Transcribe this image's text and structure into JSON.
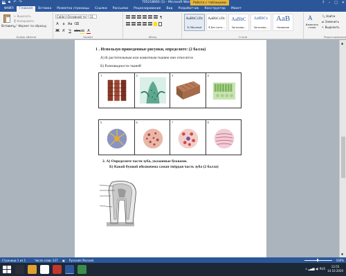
{
  "window": {
    "title": "705218660 (1) - Microsoft Word",
    "context_tab": "Работа с таблицами",
    "controls": [
      "?",
      "–",
      "□",
      "✕"
    ]
  },
  "ribbon_tabs": [
    {
      "label": "ФАЙЛ"
    },
    {
      "label": "Главная"
    },
    {
      "label": "Вставка"
    },
    {
      "label": "Разметка страницы"
    },
    {
      "label": "Ссылки"
    },
    {
      "label": "Рассылки"
    },
    {
      "label": "Рецензирование"
    },
    {
      "label": "Вид"
    },
    {
      "label": "Разработчик"
    },
    {
      "label": "Конструктор"
    },
    {
      "label": "Макет"
    }
  ],
  "clipboard": {
    "paste_label": "Вставить",
    "cut_label": "Вырезать",
    "copy_label": "Копировать",
    "format_label": "Формат по образцу",
    "group_label": "Буфер обмена"
  },
  "font": {
    "font_name": "Calibri (Основной те",
    "font_size": "11",
    "group_label": "Шрифт"
  },
  "paragraph": {
    "group_label": "Абзац"
  },
  "styles": {
    "items": [
      {
        "sample": "AaBbCcDc",
        "name": "¶ Обычный"
      },
      {
        "sample": "AaBbCcDc",
        "name": "¶ Без инте..."
      },
      {
        "sample": "AaBbC",
        "name": "Заголово..."
      },
      {
        "sample": "AaBbCc",
        "name": "Заголово..."
      },
      {
        "sample": "AaB",
        "name": "Название"
      }
    ],
    "change_label": "Изменить стили",
    "group_label": "Стили"
  },
  "editing": {
    "find_label": "Найти",
    "replace_label": "Заменить",
    "select_label": "Выделить",
    "group_label": "Редактирование"
  },
  "document": {
    "q1": "1 . Используя  приведенные  рисунки,  определите:  (2 балла)",
    "q1_a": "А) К растительным  или животным тканям они относятся",
    "q1_b": "Б) Разновидности    тканей",
    "table1_numbers": [
      "1",
      "2",
      "3",
      "4"
    ],
    "table2_numbers": [
      "5",
      "6",
      "7",
      "8"
    ],
    "q2_a": "2.   А) Определите части зуба, указанные буквами.",
    "q2_b": "Б)  Какой буквой обозначена самая твёрдая часть зуба (2 балла)"
  },
  "statusbar": {
    "page": "Страница 1 из 1",
    "words": "Число слов: 237",
    "language": "Русский (Россия)",
    "zoom": "100%"
  },
  "taskbar": {
    "language": "RUS",
    "time": "12:55",
    "date": "14.10.2020"
  },
  "colors": {
    "accent": "#2b579a",
    "context_tab": "#e6b53a",
    "taskbar": "#1d2836",
    "workspace": "#abb3bd"
  }
}
